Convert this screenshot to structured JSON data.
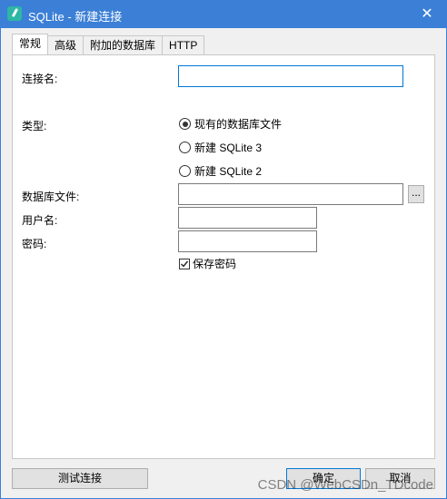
{
  "window": {
    "title": "SQLite - 新建连接",
    "close_glyph": "✕",
    "accent_color": "#3b7fd6"
  },
  "tabs": [
    {
      "label": "常规",
      "active": true
    },
    {
      "label": "高级",
      "active": false
    },
    {
      "label": "附加的数据库",
      "active": false
    },
    {
      "label": "HTTP",
      "active": false
    }
  ],
  "form": {
    "connection_name_label": "连接名:",
    "connection_name_value": "",
    "type_label": "类型:",
    "type_options": [
      {
        "label": "现有的数据库文件",
        "checked": true
      },
      {
        "label": "新建 SQLite 3",
        "checked": false
      },
      {
        "label": "新建 SQLite 2",
        "checked": false
      }
    ],
    "db_file_label": "数据库文件:",
    "db_file_value": "",
    "browse_label": "...",
    "username_label": "用户名:",
    "username_value": "",
    "password_label": "密码:",
    "password_value": "",
    "save_password_label": "保存密码",
    "save_password_checked": true
  },
  "buttons": {
    "test_label": "测试连接",
    "ok_label": "确定",
    "cancel_label": "取消"
  },
  "watermark": "CSDN @WebCSDn_TDcode"
}
